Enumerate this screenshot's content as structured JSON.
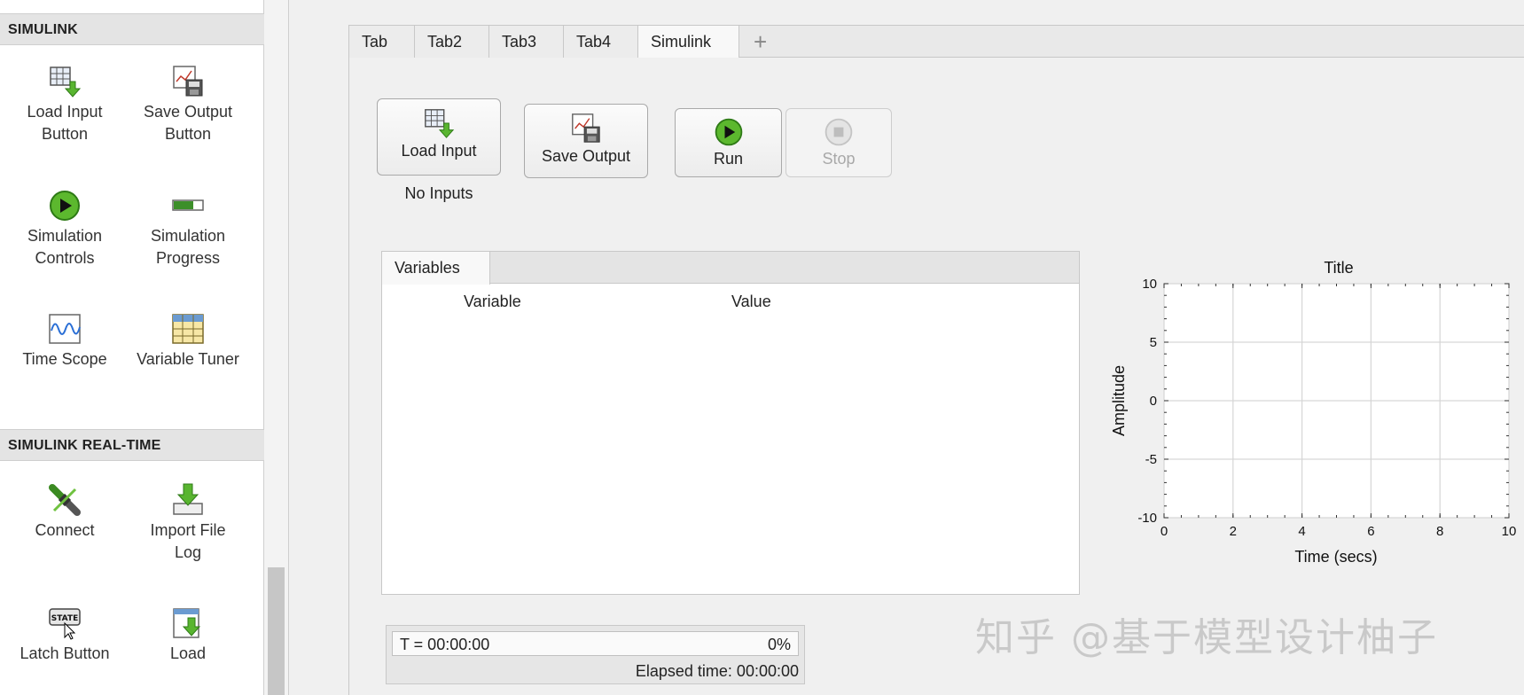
{
  "palette": {
    "section1": {
      "title": "SIMULINK"
    },
    "items1": [
      {
        "label1": "Load Input",
        "label2": "Button"
      },
      {
        "label1": "Save Output",
        "label2": "Button"
      },
      {
        "label1": "Simulation",
        "label2": "Controls"
      },
      {
        "label1": "Simulation",
        "label2": "Progress"
      },
      {
        "label1": "Time Scope",
        "label2": ""
      },
      {
        "label1": "Variable Tuner",
        "label2": ""
      }
    ],
    "section2": {
      "title": "SIMULINK REAL-TIME"
    },
    "items2": [
      {
        "label1": "Connect",
        "label2": ""
      },
      {
        "label1": "Import File",
        "label2": "Log"
      },
      {
        "label1": "Latch Button",
        "label2": ""
      },
      {
        "label1": "Load",
        "label2": ""
      }
    ],
    "latch_icon_text": "STATE"
  },
  "tabs": [
    {
      "label": "Tab"
    },
    {
      "label": "Tab2"
    },
    {
      "label": "Tab3"
    },
    {
      "label": "Tab4"
    },
    {
      "label": "Simulink"
    }
  ],
  "active_tab": "Simulink",
  "add_tab_glyph": "+",
  "buttons": {
    "load_input": "Load Input",
    "save_output": "Save Output",
    "run": "Run",
    "stop": "Stop"
  },
  "no_inputs": "No Inputs",
  "variables": {
    "tab_label": "Variables",
    "col_variable": "Variable",
    "col_value": "Value"
  },
  "progress": {
    "time_text": "T = 00:00:00",
    "percent_text": "0%",
    "percent": 0,
    "elapsed_text": "Elapsed time: 00:00:00"
  },
  "watermark": "知乎 @基于模型设计柚子",
  "colors": {
    "run_green": "#4caf2a",
    "accent_border": "#a9a9a9",
    "progress_green": "#4c9a2a"
  },
  "chart_data": {
    "type": "line",
    "title": "Title",
    "xlabel": "Time (secs)",
    "ylabel": "Amplitude",
    "xlim": [
      0,
      10
    ],
    "ylim": [
      -10,
      10
    ],
    "xticks": [
      "0",
      "2",
      "4",
      "6",
      "8",
      "10"
    ],
    "yticks": [
      "10",
      "5",
      "0",
      "-5",
      "-10"
    ],
    "grid": true,
    "series": []
  }
}
